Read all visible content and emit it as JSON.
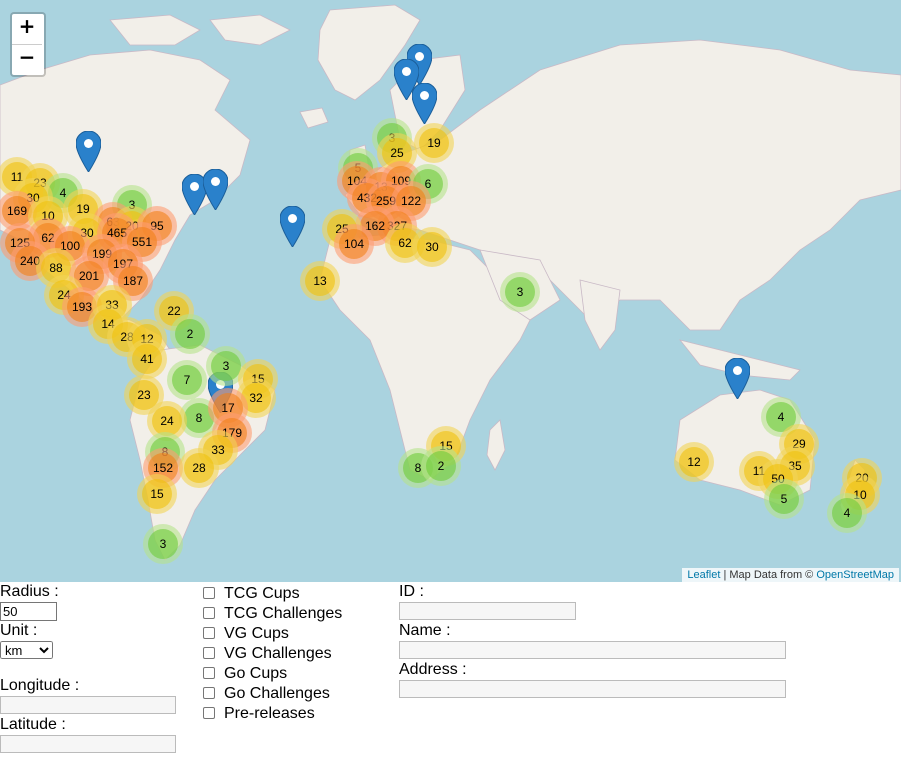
{
  "map": {
    "zoom_in": "+",
    "zoom_out": "−",
    "attribution": {
      "leaflet": "Leaflet",
      "separator": " | Map Data from © ",
      "osm": "OpenStreetMap"
    },
    "clusters": [
      {
        "n": "11",
        "s": "medium"
      },
      {
        "n": "23",
        "s": "medium"
      },
      {
        "n": "4",
        "s": "small"
      },
      {
        "n": "30",
        "s": "medium"
      },
      {
        "n": "169",
        "s": "large"
      },
      {
        "n": "10",
        "s": "medium"
      },
      {
        "n": "19",
        "s": "medium"
      },
      {
        "n": "3",
        "s": "small"
      },
      {
        "n": "63",
        "s": "large"
      },
      {
        "n": "20",
        "s": "medium"
      },
      {
        "n": "95",
        "s": "large"
      },
      {
        "n": "30",
        "s": "medium"
      },
      {
        "n": "465",
        "s": "large"
      },
      {
        "n": "62",
        "s": "large"
      },
      {
        "n": "125",
        "s": "large"
      },
      {
        "n": "551",
        "s": "large"
      },
      {
        "n": "100",
        "s": "large"
      },
      {
        "n": "240",
        "s": "large"
      },
      {
        "n": "199",
        "s": "large"
      },
      {
        "n": "197",
        "s": "large"
      },
      {
        "n": "88",
        "s": "medium"
      },
      {
        "n": "201",
        "s": "large"
      },
      {
        "n": "187",
        "s": "large"
      },
      {
        "n": "24",
        "s": "medium"
      },
      {
        "n": "193",
        "s": "large"
      },
      {
        "n": "33",
        "s": "medium"
      },
      {
        "n": "14",
        "s": "medium"
      },
      {
        "n": "22",
        "s": "medium"
      },
      {
        "n": "28",
        "s": "medium"
      },
      {
        "n": "12",
        "s": "medium"
      },
      {
        "n": "2",
        "s": "small"
      },
      {
        "n": "41",
        "s": "medium"
      },
      {
        "n": "3",
        "s": "small"
      },
      {
        "n": "7",
        "s": "small"
      },
      {
        "n": "15",
        "s": "medium"
      },
      {
        "n": "23",
        "s": "medium"
      },
      {
        "n": "32",
        "s": "medium"
      },
      {
        "n": "8",
        "s": "small"
      },
      {
        "n": "17",
        "s": "large"
      },
      {
        "n": "24",
        "s": "medium"
      },
      {
        "n": "179",
        "s": "large"
      },
      {
        "n": "33",
        "s": "medium"
      },
      {
        "n": "8",
        "s": "small"
      },
      {
        "n": "152",
        "s": "large"
      },
      {
        "n": "28",
        "s": "medium"
      },
      {
        "n": "15",
        "s": "medium"
      },
      {
        "n": "3",
        "s": "small"
      },
      {
        "n": "3",
        "s": "small"
      },
      {
        "n": "25",
        "s": "medium"
      },
      {
        "n": "19",
        "s": "medium"
      },
      {
        "n": "5",
        "s": "small"
      },
      {
        "n": "104",
        "s": "large"
      },
      {
        "n": "13",
        "s": "large"
      },
      {
        "n": "109",
        "s": "large"
      },
      {
        "n": "6",
        "s": "small"
      },
      {
        "n": "432",
        "s": "large"
      },
      {
        "n": "259",
        "s": "large"
      },
      {
        "n": "122",
        "s": "large"
      },
      {
        "n": "327",
        "s": "large"
      },
      {
        "n": "162",
        "s": "large"
      },
      {
        "n": "25",
        "s": "medium"
      },
      {
        "n": "104",
        "s": "large"
      },
      {
        "n": "62",
        "s": "medium"
      },
      {
        "n": "30",
        "s": "medium"
      },
      {
        "n": "13",
        "s": "medium"
      },
      {
        "n": "3",
        "s": "small"
      },
      {
        "n": "15",
        "s": "medium"
      },
      {
        "n": "8",
        "s": "small"
      },
      {
        "n": "2",
        "s": "small"
      },
      {
        "n": "4",
        "s": "small"
      },
      {
        "n": "29",
        "s": "medium"
      },
      {
        "n": "12",
        "s": "medium"
      },
      {
        "n": "11",
        "s": "medium"
      },
      {
        "n": "35",
        "s": "medium"
      },
      {
        "n": "50",
        "s": "medium"
      },
      {
        "n": "5",
        "s": "small"
      },
      {
        "n": "20",
        "s": "medium"
      },
      {
        "n": "10",
        "s": "medium"
      },
      {
        "n": "4",
        "s": "small"
      }
    ],
    "colors": {
      "water": "#aad3df",
      "land": "#f2efe9",
      "pin": "#2a81cb"
    }
  },
  "form": {
    "radius_label": "Radius :",
    "radius_value": "50",
    "unit_label": "Unit :",
    "unit_selected": "km",
    "longitude_label": "Longitude :",
    "latitude_label": "Latitude :",
    "checkboxes": [
      "TCG Cups",
      "TCG Challenges",
      "VG Cups",
      "VG Challenges",
      "Go Cups",
      "Go Challenges",
      "Pre-releases"
    ],
    "id_label": "ID :",
    "name_label": "Name :",
    "address_label": "Address :"
  }
}
